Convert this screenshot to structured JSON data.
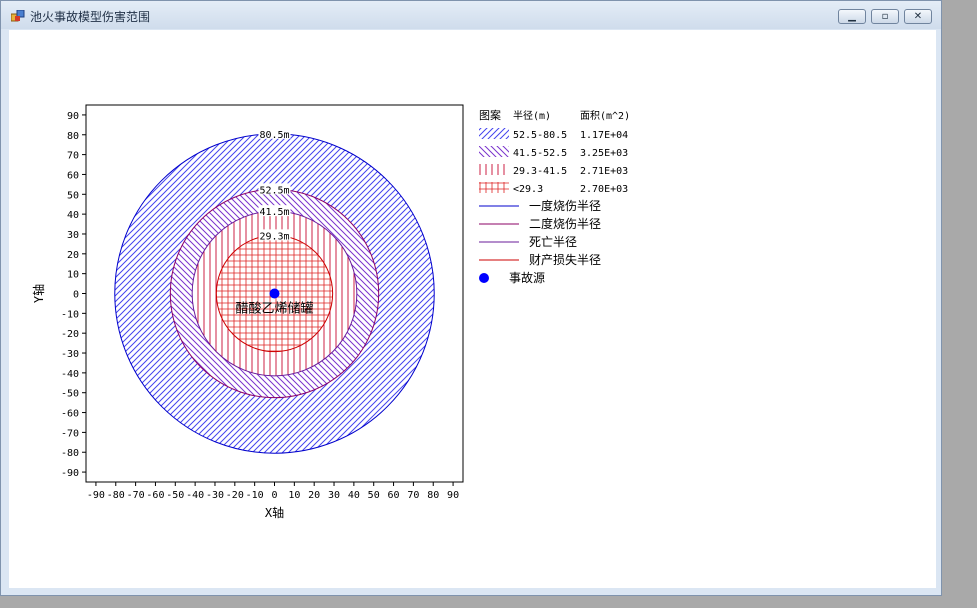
{
  "window": {
    "title": "池火事故模型伤害范围",
    "icon": "app-icon",
    "controls": [
      "minimize-icon",
      "maximize-icon",
      "close-icon"
    ]
  },
  "chart_data": {
    "type": "area",
    "xlabel": "X轴",
    "ylabel": "Y轴",
    "xlim": [
      -95,
      95
    ],
    "ylim": [
      -95,
      95
    ],
    "x_ticks": [
      -90,
      -80,
      -70,
      -60,
      -50,
      -40,
      -30,
      -20,
      -10,
      0,
      10,
      20,
      30,
      40,
      50,
      60,
      70,
      80,
      90
    ],
    "y_ticks": [
      90,
      80,
      70,
      60,
      50,
      40,
      30,
      20,
      10,
      0,
      -10,
      -20,
      -30,
      -40,
      -50,
      -60,
      -70,
      -80,
      -90
    ],
    "grid": false,
    "legend_position": "right",
    "legend_header": {
      "pattern": "图案",
      "radius": "半径(m)",
      "area": "面积(m^2)"
    },
    "zones": [
      {
        "pattern": "diagonal-up",
        "range": "52.5-80.5",
        "area": "1.17E+04",
        "color": "#4444ee"
      },
      {
        "pattern": "diagonal-down",
        "range": "41.5-52.5",
        "area": "3.25E+03",
        "color": "#7a33cc"
      },
      {
        "pattern": "vertical",
        "range": "29.3-41.5",
        "area": "2.71E+03",
        "color": "#cc2244"
      },
      {
        "pattern": "cross",
        "range": "<29.3",
        "area": "2.70E+03",
        "color": "#dd2222"
      }
    ],
    "circles": [
      {
        "name": "一度烧伤半径",
        "radius": 80.5,
        "label": "80.5m",
        "color": "#0000cc"
      },
      {
        "name": "二度烧伤半径",
        "radius": 52.5,
        "label": "52.5m",
        "color": "#8b0066"
      },
      {
        "name": "死亡半径",
        "radius": 41.5,
        "label": "41.5m",
        "color": "#6a1b9a"
      },
      {
        "name": "财产损失半径",
        "radius": 29.3,
        "label": "29.3m",
        "color": "#cc0000"
      }
    ],
    "source": {
      "name": "事故源",
      "x": 0,
      "y": 0,
      "label": "醋酸乙烯储罐",
      "color": "#0000ff"
    }
  }
}
